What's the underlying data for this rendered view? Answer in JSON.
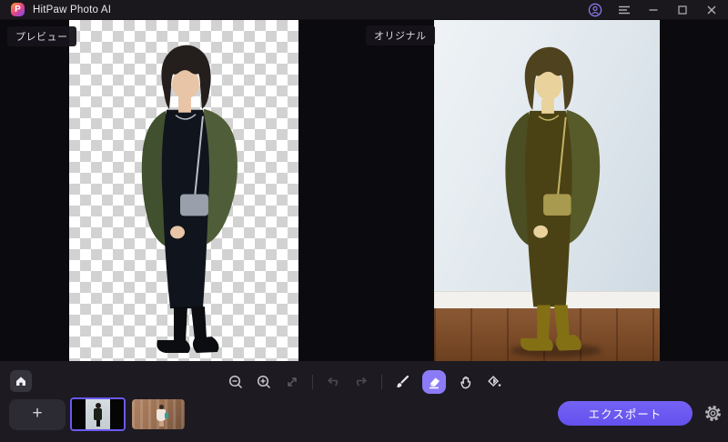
{
  "window": {
    "title": "HitPaw Photo AI"
  },
  "titlebar": {
    "icons": [
      "account-icon",
      "menu-icon",
      "minimize-icon",
      "maximize-icon",
      "close-icon"
    ]
  },
  "panels": {
    "preview_label": "プレビュー",
    "original_label": "オリジナル"
  },
  "toolbar": {
    "selected_tool": "eraser",
    "tools": [
      "home",
      "zoom-out",
      "zoom-in",
      "expand",
      "undo",
      "redo",
      "brush",
      "eraser",
      "hand",
      "fill"
    ]
  },
  "footer": {
    "add_label": "+",
    "export_label": "エクスポート",
    "thumbnails": [
      {
        "name": "portrait-photo",
        "selected": true
      },
      {
        "name": "street-photo",
        "selected": false
      }
    ],
    "icons": [
      "add",
      "gear-icon"
    ]
  },
  "colors": {
    "accent_purple": "#7b68f5",
    "export_button": "#6450ee",
    "selected_thumb_border": "#6a5af0",
    "eraser_selected_bg": "#8b7bf8"
  }
}
